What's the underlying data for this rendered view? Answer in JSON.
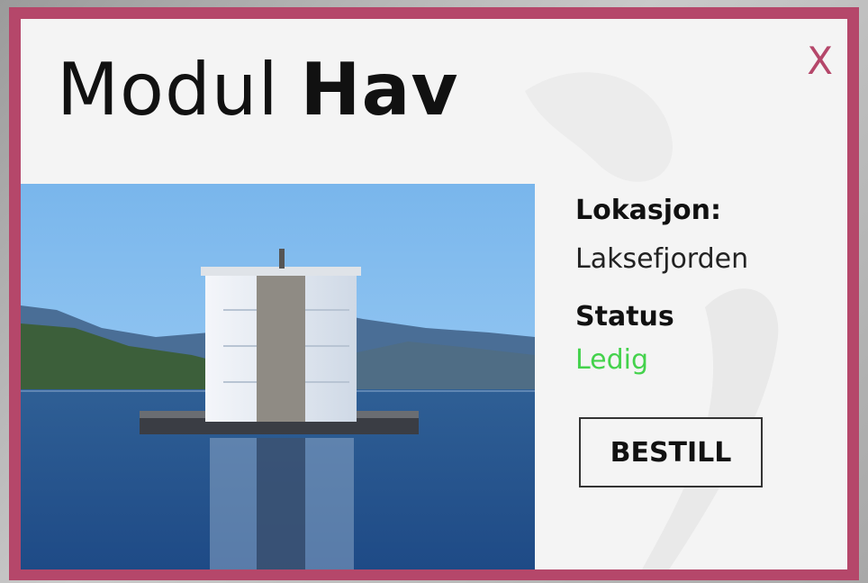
{
  "modal": {
    "title_prefix": "Modul",
    "title_name": "Hav",
    "close_label": "X"
  },
  "info": {
    "location_label": "Lokasjon:",
    "location_value": "Laksefjorden",
    "status_label": "Status",
    "status_value": "Ledig"
  },
  "actions": {
    "book_label": "BESTILL"
  },
  "colors": {
    "accent": "#b5476a",
    "status_available": "#44d24c"
  }
}
